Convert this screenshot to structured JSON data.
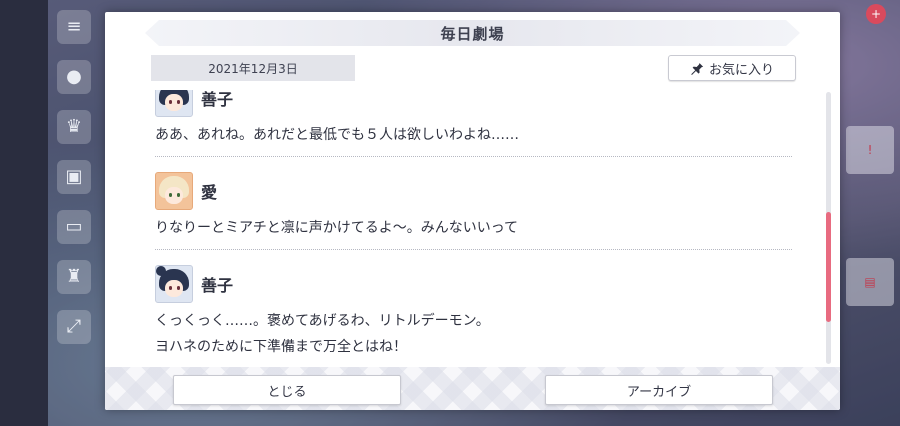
{
  "dialog": {
    "title": "毎日劇場",
    "date": "2021年12月3日",
    "favorite_label": "お気に入り"
  },
  "messages": [
    {
      "speaker": "善子",
      "lines": [
        "ああ、あれね。あれだと最低でも５人は欲しいわよね……"
      ]
    },
    {
      "speaker": "愛",
      "lines": [
        "りなりーとミアチと凛に声かけてるよ〜。みんないいって"
      ]
    },
    {
      "speaker": "善子",
      "lines": [
        "くっくっく……。褒めてあげるわ、リトルデーモン。",
        "ヨハネのために下準備まで万全とはね！"
      ]
    }
  ],
  "footer": {
    "close_label": "とじる",
    "archive_label": "アーカイブ"
  },
  "colors": {
    "accent": "#e86b80",
    "title_bar": "#e6e7ee",
    "date_tab": "#e3e4ea"
  },
  "icons": {
    "favorite": "pin-icon"
  }
}
